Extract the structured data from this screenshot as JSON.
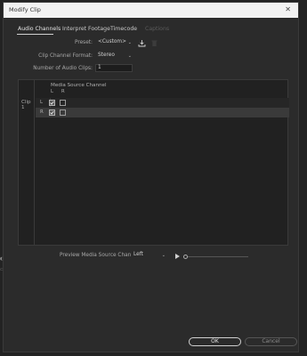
{
  "dialog": {
    "title": "Modify Clip",
    "close_glyph": "✕"
  },
  "tabs": [
    {
      "label": "Audio Channels",
      "state": "active"
    },
    {
      "label": "Interpret Footage",
      "state": "normal"
    },
    {
      "label": "Timecode",
      "state": "normal"
    },
    {
      "label": "Captions",
      "state": "disabled"
    }
  ],
  "form": {
    "preset_label": "Preset:",
    "preset_value": "<Custom>",
    "format_label": "Clip Channel Format:",
    "format_value": "Stereo",
    "num_clips_label": "Number of Audio Clips:",
    "num_clips_value": "1"
  },
  "grid": {
    "header": "Media Source Channel",
    "col_l": "L",
    "col_r": "R",
    "clip_label": "Clip 1",
    "rows": [
      {
        "channel": "L",
        "l_checked": true,
        "r_checked": false
      },
      {
        "channel": "R",
        "l_checked": true,
        "r_checked": false
      }
    ]
  },
  "preview": {
    "label": "Preview Media Source Channel:",
    "value": "Left",
    "volume": 0.05
  },
  "buttons": {
    "ok": "OK",
    "cancel": "Cancel"
  },
  "icons": {
    "save_preset": "save-preset-icon",
    "delete_preset": "trash-icon",
    "play": "play-icon",
    "dropdown": "chevron-down-icon",
    "checkmark": "checkmark-icon"
  },
  "colors": {
    "dialog_bg": "#2b2b2b",
    "titlebar_bg": "#f2f2f2",
    "selected_row": "#3a3a3a"
  }
}
